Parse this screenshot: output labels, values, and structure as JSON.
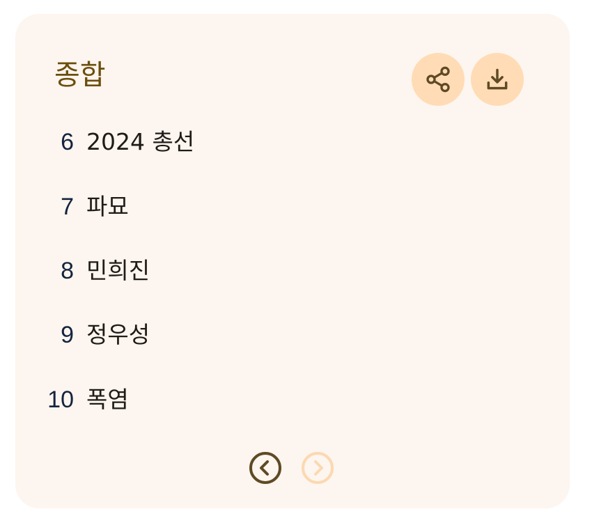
{
  "card": {
    "title": "종합",
    "share_icon": "share-icon",
    "download_icon": "download-icon",
    "items": [
      {
        "rank": "6",
        "term": "2024 총선"
      },
      {
        "rank": "7",
        "term": "파묘"
      },
      {
        "rank": "8",
        "term": "민희진"
      },
      {
        "rank": "9",
        "term": "정우성"
      },
      {
        "rank": "10",
        "term": "폭염"
      }
    ],
    "prev_icon": "chevron-left-circle-icon",
    "next_icon": "chevron-right-circle-icon"
  },
  "colors": {
    "card_background": "#fdf5ef",
    "title": "#6b4e0c",
    "icon_button_background": "#ffdcb5",
    "icon_stroke": "#5e4a24",
    "rank_number": "#13243f",
    "term_text": "#1f1b16",
    "pager_enabled": "#5e4a24",
    "pager_disabled": "#fbd9b1"
  }
}
